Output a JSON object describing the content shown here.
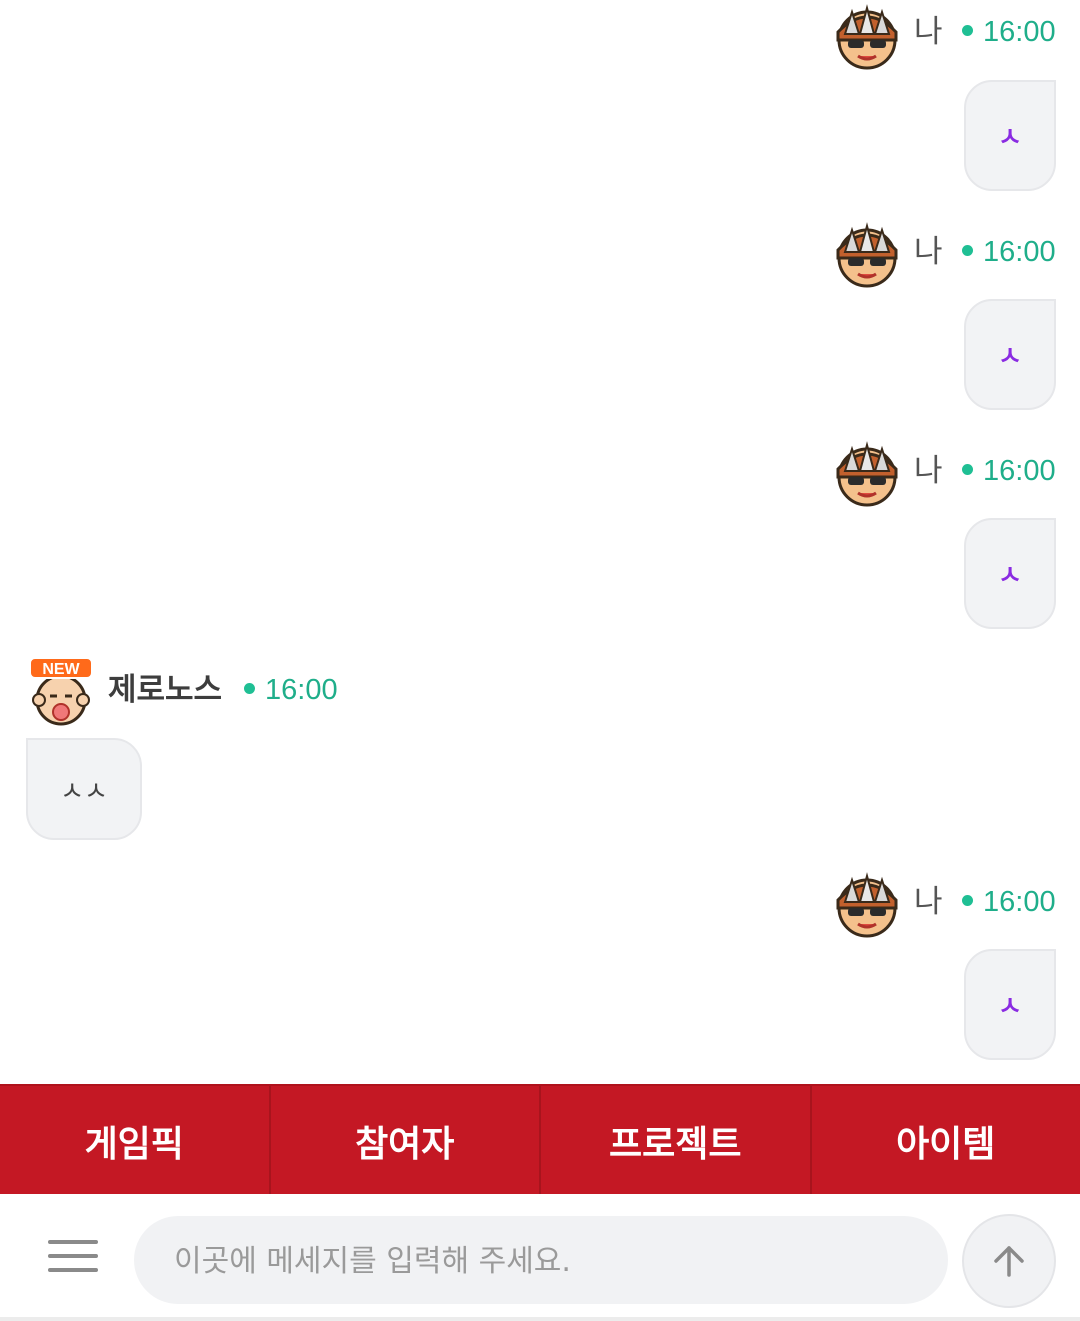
{
  "messages": [
    {
      "sender": "나",
      "time": "16:00",
      "text": "ㅅ",
      "mine": true,
      "avatar": "spiked-helmet-avatar-icon"
    },
    {
      "sender": "나",
      "time": "16:00",
      "text": "ㅅ",
      "mine": true,
      "avatar": "spiked-helmet-avatar-icon"
    },
    {
      "sender": "나",
      "time": "16:00",
      "text": "ㅅ",
      "mine": true,
      "avatar": "spiked-helmet-avatar-icon"
    },
    {
      "sender": "제로노스",
      "time": "16:00",
      "text": "ㅅㅅ",
      "mine": false,
      "avatar": "new-badge-baby-avatar-icon",
      "badge": "NEW"
    },
    {
      "sender": "나",
      "time": "16:00",
      "text": "ㅅ",
      "mine": true,
      "avatar": "spiked-helmet-avatar-icon"
    }
  ],
  "tabs": [
    {
      "label": "게임픽"
    },
    {
      "label": "참여자"
    },
    {
      "label": "프로젝트"
    },
    {
      "label": "아이템"
    }
  ],
  "composer": {
    "placeholder": "이곳에 메세지를 입력해 주세요.",
    "menu_icon": "hamburger-menu-icon",
    "send_icon": "arrow-up-icon"
  },
  "colors": {
    "tab_bar": "#c41824",
    "time_green": "#1fae8a",
    "mine_text": "#8a2be2",
    "bubble_bg": "#f2f3f5"
  }
}
